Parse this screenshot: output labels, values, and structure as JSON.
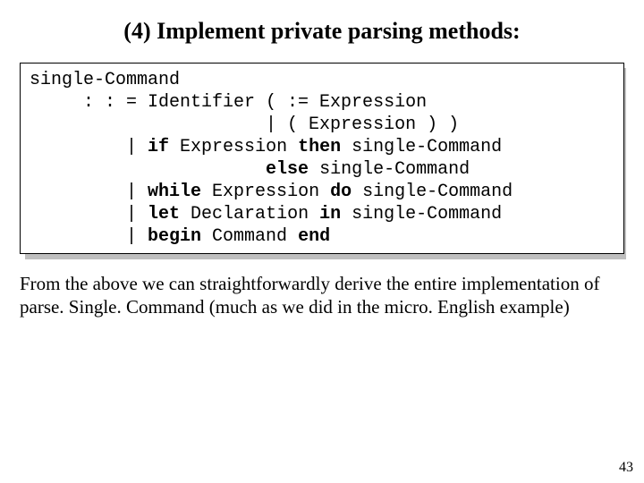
{
  "title": "(4) Implement private parsing methods:",
  "grammar": {
    "l1": "single-Command",
    "l2a": "     : : = Identifier ( := Expression",
    "l3a": "                      | ( Expression ) )",
    "l4a": "         | ",
    "l4if": "if",
    "l4b": " Expression ",
    "l4then": "then",
    "l4c": " single-Command",
    "l5a": "                      ",
    "l5else": "else",
    "l5b": " single-Command",
    "l6a": "         | ",
    "l6while": "while",
    "l6b": " Expression ",
    "l6do": "do",
    "l6c": " single-Command",
    "l7a": "         | ",
    "l7let": "let",
    "l7b": " Declaration ",
    "l7in": "in",
    "l7c": " single-Command",
    "l8a": "         | ",
    "l8begin": "begin",
    "l8b": " Command ",
    "l8end": "end"
  },
  "paragraph": "From the above we can straightforwardly derive the entire implementation of parse. Single. Command (much as we did in the micro. English example)",
  "page_number": "43"
}
